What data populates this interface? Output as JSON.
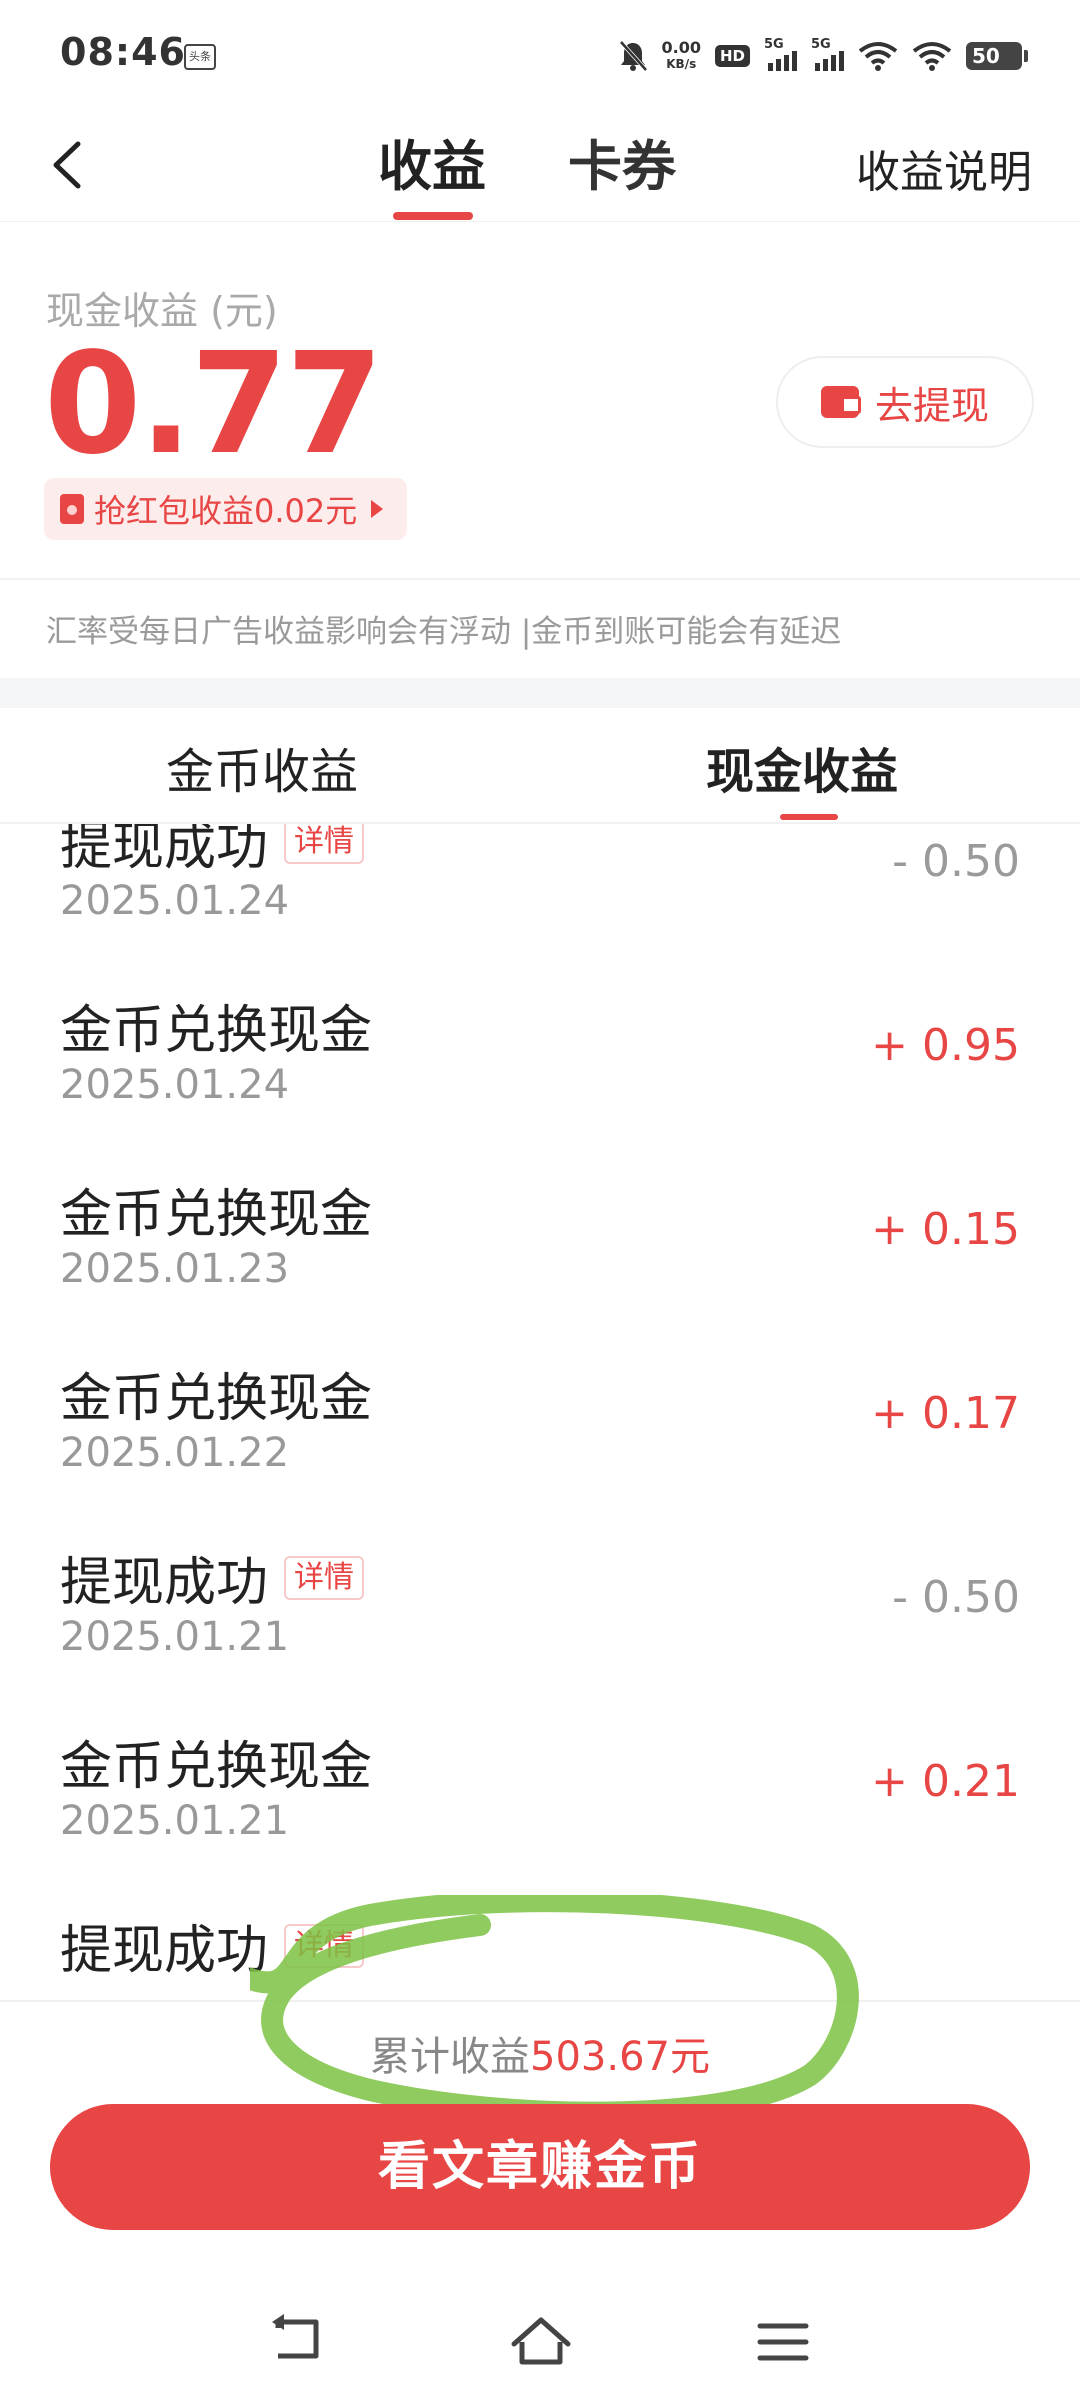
{
  "status_bar": {
    "time": "08:46",
    "app_badge": "头条",
    "speed_value": "0.00",
    "speed_unit": "KB/s",
    "hd_label": "HD",
    "sim1": "5G",
    "sim2": "5G",
    "battery": "50"
  },
  "nav": {
    "tab_earnings": "收益",
    "tab_coupons": "卡券",
    "help_link": "收益说明"
  },
  "earnings": {
    "label": "现金收益 (元)",
    "amount": "0.77",
    "red_packet": "抢红包收益0.02元",
    "withdraw_button": "去提现"
  },
  "notice": "汇率受每日广告收益影响会有浮动 |金币到账可能会有延迟",
  "sub_tabs": {
    "coins": "金币收益",
    "cash": "现金收益"
  },
  "detail_tag": "详情",
  "records": [
    {
      "title": "提现成功",
      "date": "2025.01.24",
      "amount": "- 0.50",
      "type": "withdraw"
    },
    {
      "title": "金币兑换现金",
      "date": "2025.01.24",
      "amount": "+ 0.95",
      "type": "income"
    },
    {
      "title": "金币兑换现金",
      "date": "2025.01.23",
      "amount": "+ 0.15",
      "type": "income"
    },
    {
      "title": "金币兑换现金",
      "date": "2025.01.22",
      "amount": "+ 0.17",
      "type": "income"
    },
    {
      "title": "提现成功",
      "date": "2025.01.21",
      "amount": "- 0.50",
      "type": "withdraw"
    },
    {
      "title": "金币兑换现金",
      "date": "2025.01.21",
      "amount": "+ 0.21",
      "type": "income"
    },
    {
      "title": "提现成功",
      "date": "",
      "amount": "",
      "type": "withdraw"
    }
  ],
  "total": {
    "label": "累计收益",
    "value": "503.67元"
  },
  "cta_button": "看文章赚金币",
  "colors": {
    "accent": "#e84545",
    "highlight_marker": "#7cc243"
  }
}
